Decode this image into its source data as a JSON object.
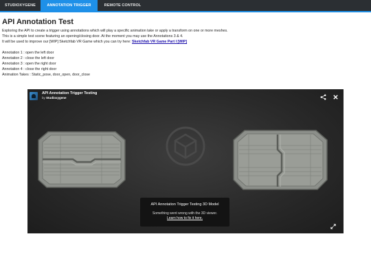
{
  "nav": {
    "tabs": [
      {
        "label": "STUDIOXYGENE",
        "active": false
      },
      {
        "label": "ANNOTATION TRIGGER",
        "active": true
      },
      {
        "label": "REMOTE CONTROL",
        "active": false
      }
    ],
    "accent_color": "#1e90e8"
  },
  "page": {
    "title": "API Annotation Test",
    "intro_1": "Exploring the API to create a trigger using annotations which will play a specific animation take or apply a transform on one or more meshes.",
    "intro_2": "This is a simple test scene featuring an opening/closing door. At the moment you may use the Annotations 3 & 4.",
    "intro_3_prefix": "It will be used to improve our [WIP] Sketchfab VR Game which you can try here: ",
    "intro_3_link": "Sketchfab VR Game Part I [WIP]",
    "annotations": [
      "Annotation 1 : open the left door",
      "Annotation 2 : close the left door",
      "Annotation 3 : open the right door",
      "Annotation 4 : close the right door"
    ],
    "animation_takes": "Animation Takes : Static_pose, door_open, door_close"
  },
  "viewer": {
    "model_title": "API Annotation Trigger Testing",
    "by_prefix": "by ",
    "author": "Studioxygene",
    "message": {
      "title": "API Annotation Trigger Testing 3D Model",
      "text": "Something went wrong with the 3D viewer.",
      "link": "Learn how to fix it here."
    },
    "icons": [
      "share-icon",
      "close-icon",
      "fullscreen-icon"
    ]
  }
}
